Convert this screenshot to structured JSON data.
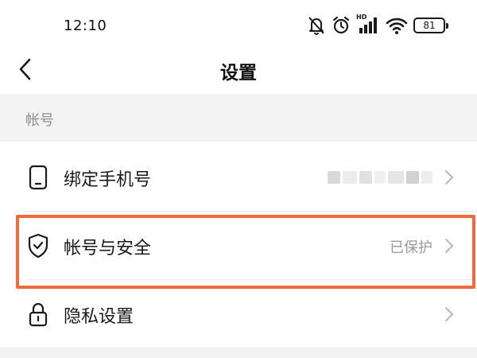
{
  "status_bar": {
    "time": "12:10",
    "icons": [
      "bell-muted-icon",
      "alarm-icon",
      "hd-signal-icon",
      "wifi-icon",
      "battery-icon"
    ],
    "hd_label": "HD",
    "battery_level": "81"
  },
  "nav": {
    "back_icon": "chevron-left-icon",
    "title": "设置"
  },
  "account_section": {
    "title": "帐号",
    "items": [
      {
        "label": "绑定手机号",
        "value": "",
        "value_obscured": true,
        "icon": "phone-icon"
      },
      {
        "label": "帐号与安全",
        "value": "已保护",
        "icon": "shield-check-icon"
      },
      {
        "label": "隐私设置",
        "value": "",
        "icon": "lock-icon"
      }
    ]
  },
  "colors": {
    "highlight": "#f06a3c",
    "section_background": "#f3f3f3",
    "secondary_text": "#9a9a9a"
  }
}
